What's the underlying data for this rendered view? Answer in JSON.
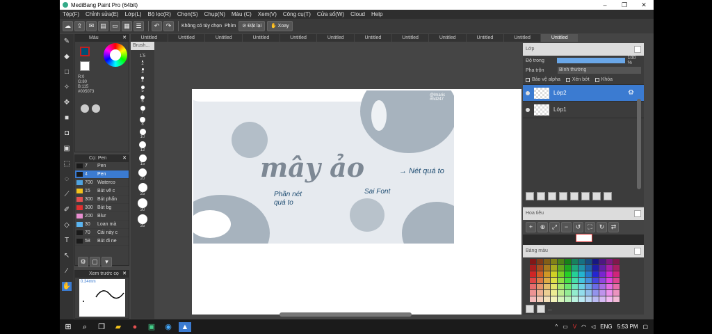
{
  "window": {
    "title": "MediBang Paint Pro (64bit)",
    "min": "–",
    "max": "❐",
    "close": "✕"
  },
  "menu": [
    "Tệp(F)",
    "Chỉnh sửa(E)",
    "Lớp(L)",
    "Bộ lọc(R)",
    "Chọn(S)",
    "Chụp(N)",
    "Màu (C)",
    "Xem(V)",
    "Công cụ(T)",
    "Cửa sổ(W)",
    "Cloud",
    "Help"
  ],
  "toolbar": {
    "snap_label": "Không có tùy chọn",
    "shortcut_label": "Phím",
    "reset_label": "Đặt lại",
    "rotate_label": "Xoay"
  },
  "tabs": [
    "Untitled",
    "Untitled",
    "Untitled",
    "Untitled",
    "Untitled",
    "Untitled",
    "Untitled",
    "Untitled",
    "Untitled",
    "Untitled",
    "Untitled",
    "Untitled"
  ],
  "color_panel": {
    "title": "Màu",
    "r": "R:0",
    "g": "G:80",
    "b": "B:115",
    "hex": "#005073",
    "main_color": "#005073"
  },
  "brush_panel": {
    "title": "Cọ: Pen",
    "items": [
      {
        "size": "7",
        "name": "Pen",
        "color": "#1a1a1a"
      },
      {
        "size": "4",
        "name": "Pen",
        "color": "#1a1a1a"
      },
      {
        "size": "700",
        "name": "Waterco",
        "color": "#4fa3e0"
      },
      {
        "size": "15",
        "name": "Bút vẽ c",
        "color": "#f3c21c"
      },
      {
        "size": "300",
        "name": "Bút phấn",
        "color": "#e45050"
      },
      {
        "size": "300",
        "name": "Bút bg",
        "color": "#e03030"
      },
      {
        "size": "200",
        "name": "Blur",
        "color": "#e88ed0"
      },
      {
        "size": "30",
        "name": "Loan mà",
        "color": "#5ab4f0"
      },
      {
        "size": "70",
        "name": "Cái này c",
        "color": "#1a1a1a"
      },
      {
        "size": "58",
        "name": "Bút đi ne",
        "color": "#1a1a1a"
      }
    ]
  },
  "preview_panel": {
    "title": "Xem trước cọ",
    "size": "0.34mm"
  },
  "size_panel": {
    "title": "Brush...",
    "sizes": [
      "1.5",
      "2",
      "3",
      "4",
      "5",
      "6",
      "7",
      "8",
      "10",
      "12",
      "15",
      "20",
      "25",
      "30",
      "35"
    ]
  },
  "layer_panel": {
    "title": "Lớp",
    "opacity_label": "Độ trong",
    "opacity_value": "100 %",
    "blend_label": "Pha trộn",
    "blend_value": "Bình thường",
    "protect_alpha": "Bảo vệ alpha",
    "clipping": "Xén bớt",
    "lock": "Khóa",
    "layers": [
      {
        "name": "Lớp2"
      },
      {
        "name": "Lớp1"
      }
    ]
  },
  "navigator_panel": {
    "title": "Hoa tiêu"
  },
  "palette_panel": {
    "title": "Bảng màu",
    "more": "..."
  },
  "canvas": {
    "watermark": "@lmaric\n#hd247",
    "word": "mây ảo",
    "note_left": "Phần nét\nquá to",
    "note_mid": "Sai Font",
    "note_right": "→ Nét quá to"
  },
  "taskbar": {
    "lang": "ENG",
    "time": "5:53 PM"
  }
}
